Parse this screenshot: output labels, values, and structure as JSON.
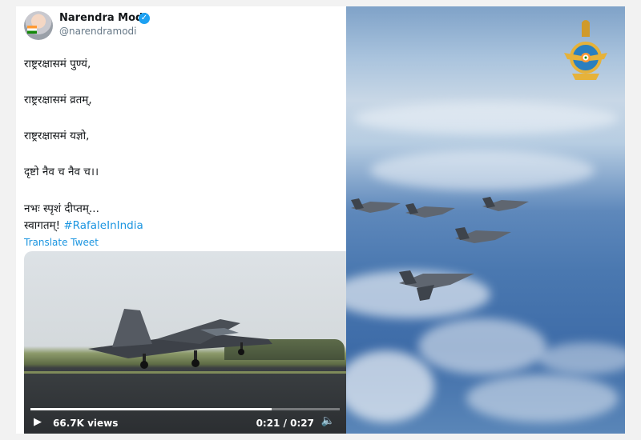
{
  "tweet": {
    "author_name": "Narendra Modi",
    "handle": "@narendramodi",
    "lines": [
      "राष्ट्ररक्षासमं पुण्यं,",
      "राष्ट्ररक्षासमं व्रतम्,",
      "राष्ट्ररक्षासमं यज्ञो,",
      "दृष्टो नैव च नैव च।।",
      "नभः स्पृशं दीप्तम्..."
    ],
    "welcome_text": "स्वागतम्!",
    "hashtag": "#RafaleInIndia",
    "translate_label": "Translate Tweet"
  },
  "video": {
    "views": "66.7K views",
    "time": "0:21 / 0:27",
    "progress": 0.78
  },
  "colors": {
    "link": "#1b95e0",
    "verified": "#1da1f2"
  },
  "icons": [
    "verified-badge-icon",
    "play-icon",
    "volume-icon",
    "iaf-emblem-icon"
  ]
}
